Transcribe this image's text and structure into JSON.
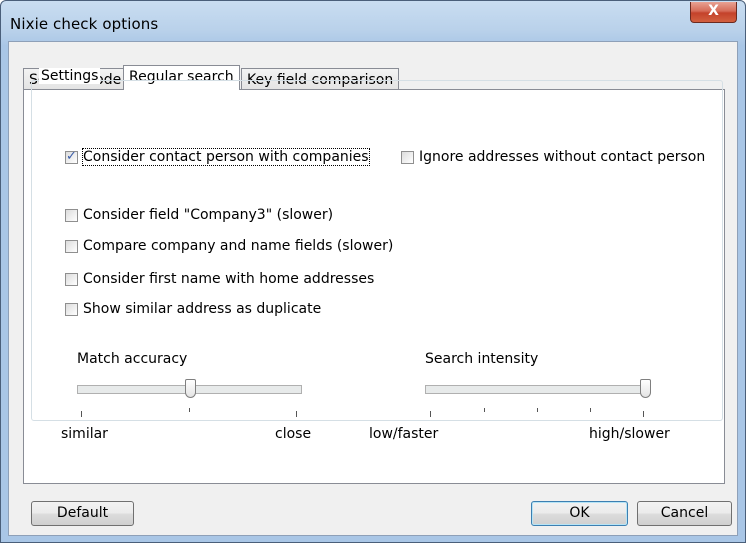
{
  "window": {
    "title": "Nixie check options",
    "close_glyph": "X"
  },
  "tabs": [
    {
      "label": "Search mode",
      "active": false
    },
    {
      "label": "Regular search",
      "active": true
    },
    {
      "label": "Key field comparison",
      "active": false
    }
  ],
  "settings": {
    "group_label": "Settings",
    "options": [
      {
        "label": "Consider contact person with companies",
        "checked": true
      },
      {
        "label": "Ignore addresses without contact person",
        "checked": false
      },
      {
        "label": "Consider field \"Company3\" (slower)",
        "checked": false
      },
      {
        "label": "Compare company and name fields (slower)",
        "checked": false
      },
      {
        "label": "Consider first name with home addresses",
        "checked": false
      },
      {
        "label": "Show similar address as duplicate",
        "checked": false
      }
    ],
    "match_accuracy": {
      "label": "Match accuracy",
      "min_label": "similar",
      "max_label": "close",
      "value": 1,
      "max": 2
    },
    "search_intensity": {
      "label": "Search intensity",
      "min_label": "low/faster",
      "max_label": "high/slower",
      "value": 4,
      "max": 4
    }
  },
  "buttons": {
    "default": "Default",
    "ok": "OK",
    "cancel": "Cancel"
  }
}
